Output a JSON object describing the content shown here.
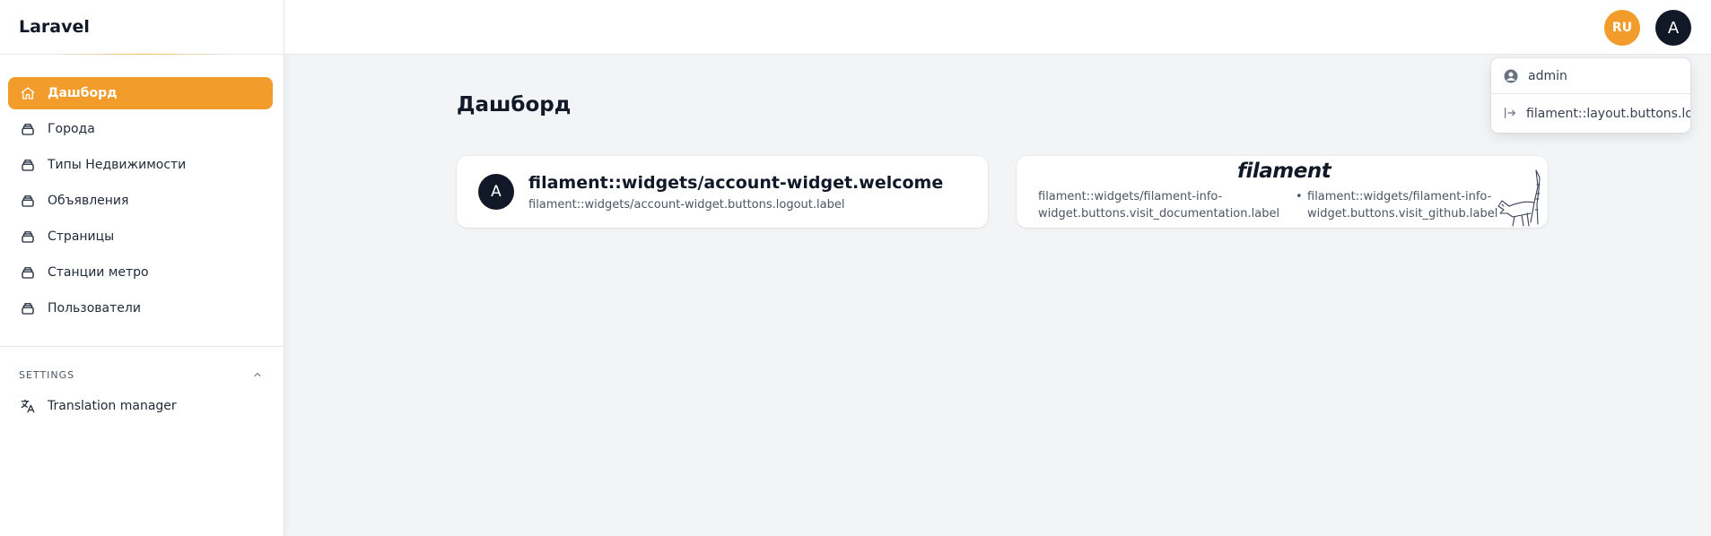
{
  "sidebar": {
    "brand": "Laravel",
    "items": [
      {
        "label": "Дашборд",
        "icon": "home-icon"
      },
      {
        "label": "Города",
        "icon": "collection-icon"
      },
      {
        "label": "Типы Недвижимости",
        "icon": "collection-icon"
      },
      {
        "label": "Объявления",
        "icon": "collection-icon"
      },
      {
        "label": "Страницы",
        "icon": "collection-icon"
      },
      {
        "label": "Станции метро",
        "icon": "collection-icon"
      },
      {
        "label": "Пользователи",
        "icon": "collection-icon"
      }
    ],
    "group": {
      "title": "SETTINGS",
      "items": [
        {
          "label": "Translation manager",
          "icon": "translate-icon"
        }
      ]
    }
  },
  "topbar": {
    "language": "RU",
    "avatar_initial": "A"
  },
  "user_menu": {
    "user_name": "admin",
    "logout_label": "filament::layout.buttons.logout.label"
  },
  "main": {
    "title": "Дашборд",
    "account_widget": {
      "avatar_initial": "A",
      "welcome": "filament::widgets/account-widget.welcome",
      "logout_label": "filament::widgets/account-widget.buttons.logout.label"
    },
    "info_widget": {
      "logo": "filament",
      "docs_label": "filament::widgets/filament-info-widget.buttons.visit_documentation.label",
      "github_label": "filament::widgets/filament-info-widget.buttons.visit_github.label"
    }
  },
  "colors": {
    "accent": "#f29c2c",
    "dark": "#111827",
    "background": "#f3f4f6"
  }
}
